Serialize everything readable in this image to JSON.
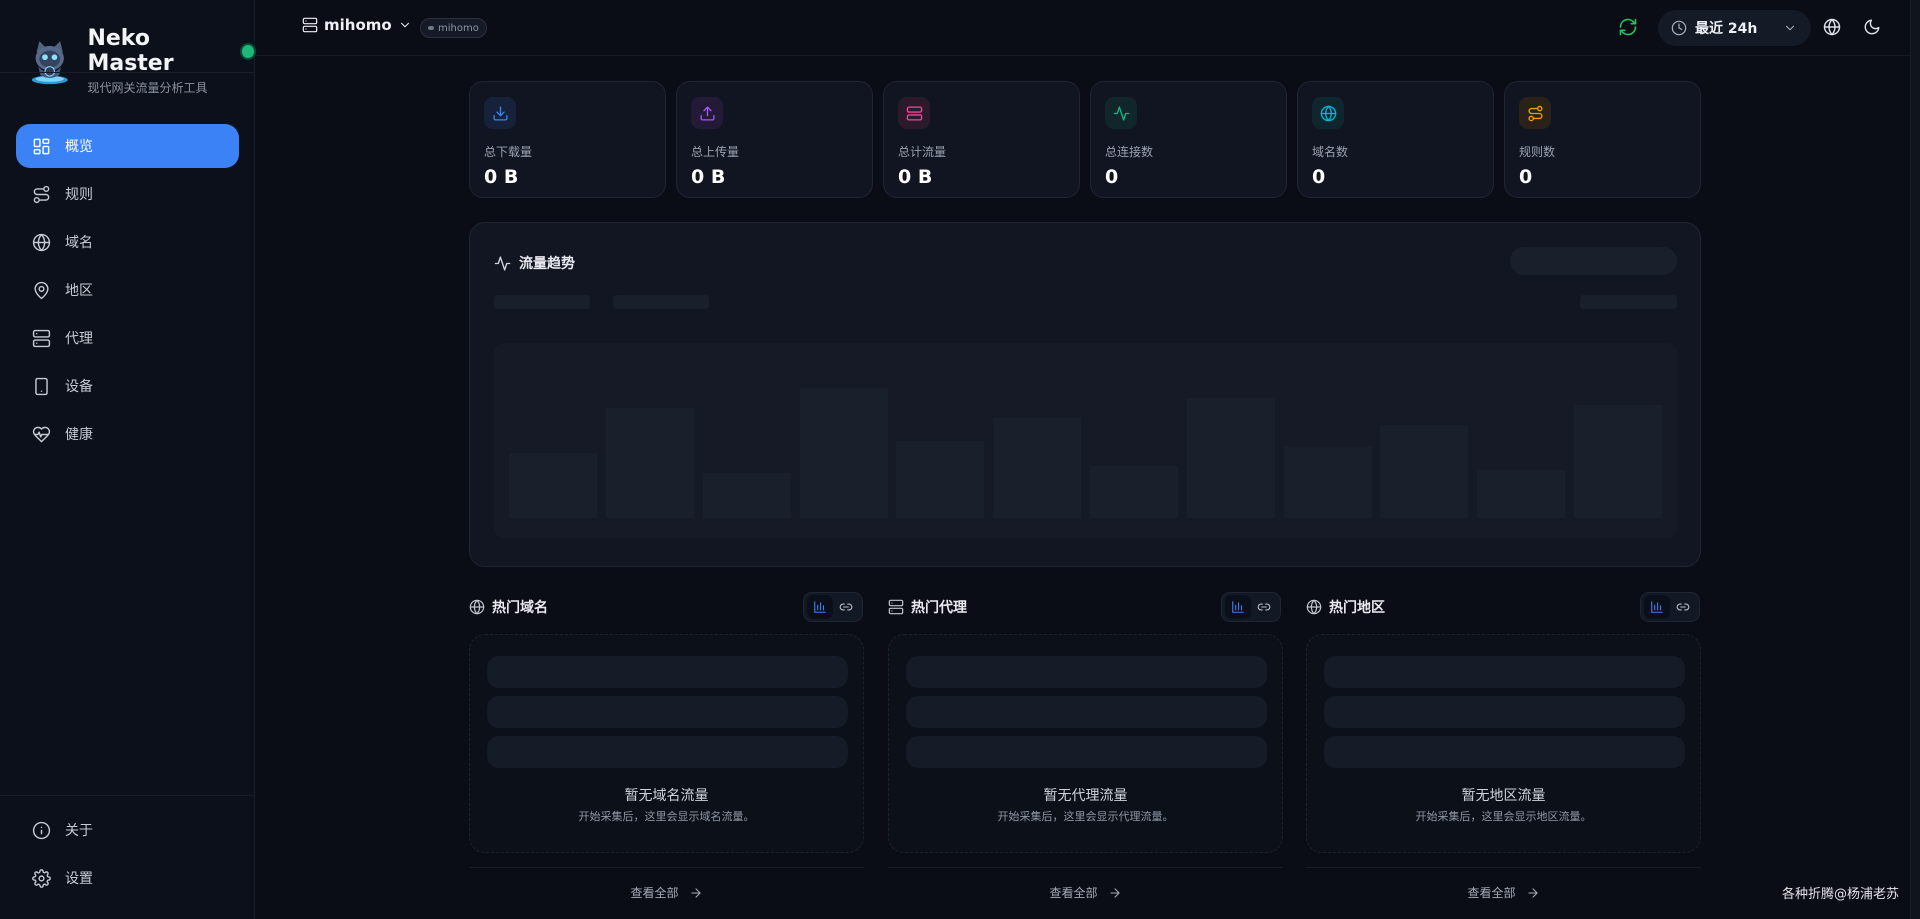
{
  "brand": {
    "title": "Neko Master",
    "subtitle": "现代网关流量分析工具"
  },
  "nav": {
    "items": [
      {
        "label": "概览",
        "icon": "dashboard-icon",
        "active": true
      },
      {
        "label": "规则",
        "icon": "route-icon",
        "active": false
      },
      {
        "label": "域名",
        "icon": "globe-icon",
        "active": false
      },
      {
        "label": "地区",
        "icon": "map-pin-icon",
        "active": false
      },
      {
        "label": "代理",
        "icon": "server-icon",
        "active": false
      },
      {
        "label": "设备",
        "icon": "smartphone-icon",
        "active": false
      },
      {
        "label": "健康",
        "icon": "heart-pulse-icon",
        "active": false
      }
    ],
    "bottom": [
      {
        "label": "关于",
        "icon": "info-icon"
      },
      {
        "label": "设置",
        "icon": "gear-icon"
      }
    ]
  },
  "topbar": {
    "backend_name": "mihomo",
    "backend_badge": "mihomo",
    "time_range": "最近 24h"
  },
  "stats": [
    {
      "label": "总下载量",
      "value": "0 B",
      "icon": "download-icon",
      "color": "#3b82f6",
      "bg": "#17213a"
    },
    {
      "label": "总上传量",
      "value": "0 B",
      "icon": "upload-icon",
      "color": "#a855f7",
      "bg": "#221a37"
    },
    {
      "label": "总计流量",
      "value": "0 B",
      "icon": "server-icon",
      "color": "#ec4899",
      "bg": "#2a1a2b"
    },
    {
      "label": "总连接数",
      "value": "0",
      "icon": "activity-icon",
      "color": "#10b981",
      "bg": "#11262a"
    },
    {
      "label": "域名数",
      "value": "0",
      "icon": "globe-icon",
      "color": "#06b6d4",
      "bg": "#10262f"
    },
    {
      "label": "规则数",
      "value": "0",
      "icon": "route-icon",
      "color": "#f59e0b",
      "bg": "#2a2219"
    }
  ],
  "trend": {
    "title": "流量趋势"
  },
  "sections": [
    {
      "title": "热门域名",
      "icon": "globe-icon",
      "empty_title": "暂无域名流量",
      "empty_sub": "开始采集后，这里会显示域名流量。",
      "view_all": "查看全部"
    },
    {
      "title": "热门代理",
      "icon": "server-icon",
      "empty_title": "暂无代理流量",
      "empty_sub": "开始采集后，这里会显示代理流量。",
      "view_all": "查看全部"
    },
    {
      "title": "热门地区",
      "icon": "globe-icon",
      "empty_title": "暂无地区流量",
      "empty_sub": "开始采集后，这里会显示地区流量。",
      "view_all": "查看全部"
    }
  ],
  "watermark": "各种折腾@杨浦老苏",
  "colors": {
    "accent": "#3b82f6",
    "online": "#1db97a",
    "refresh": "#22c55e"
  }
}
